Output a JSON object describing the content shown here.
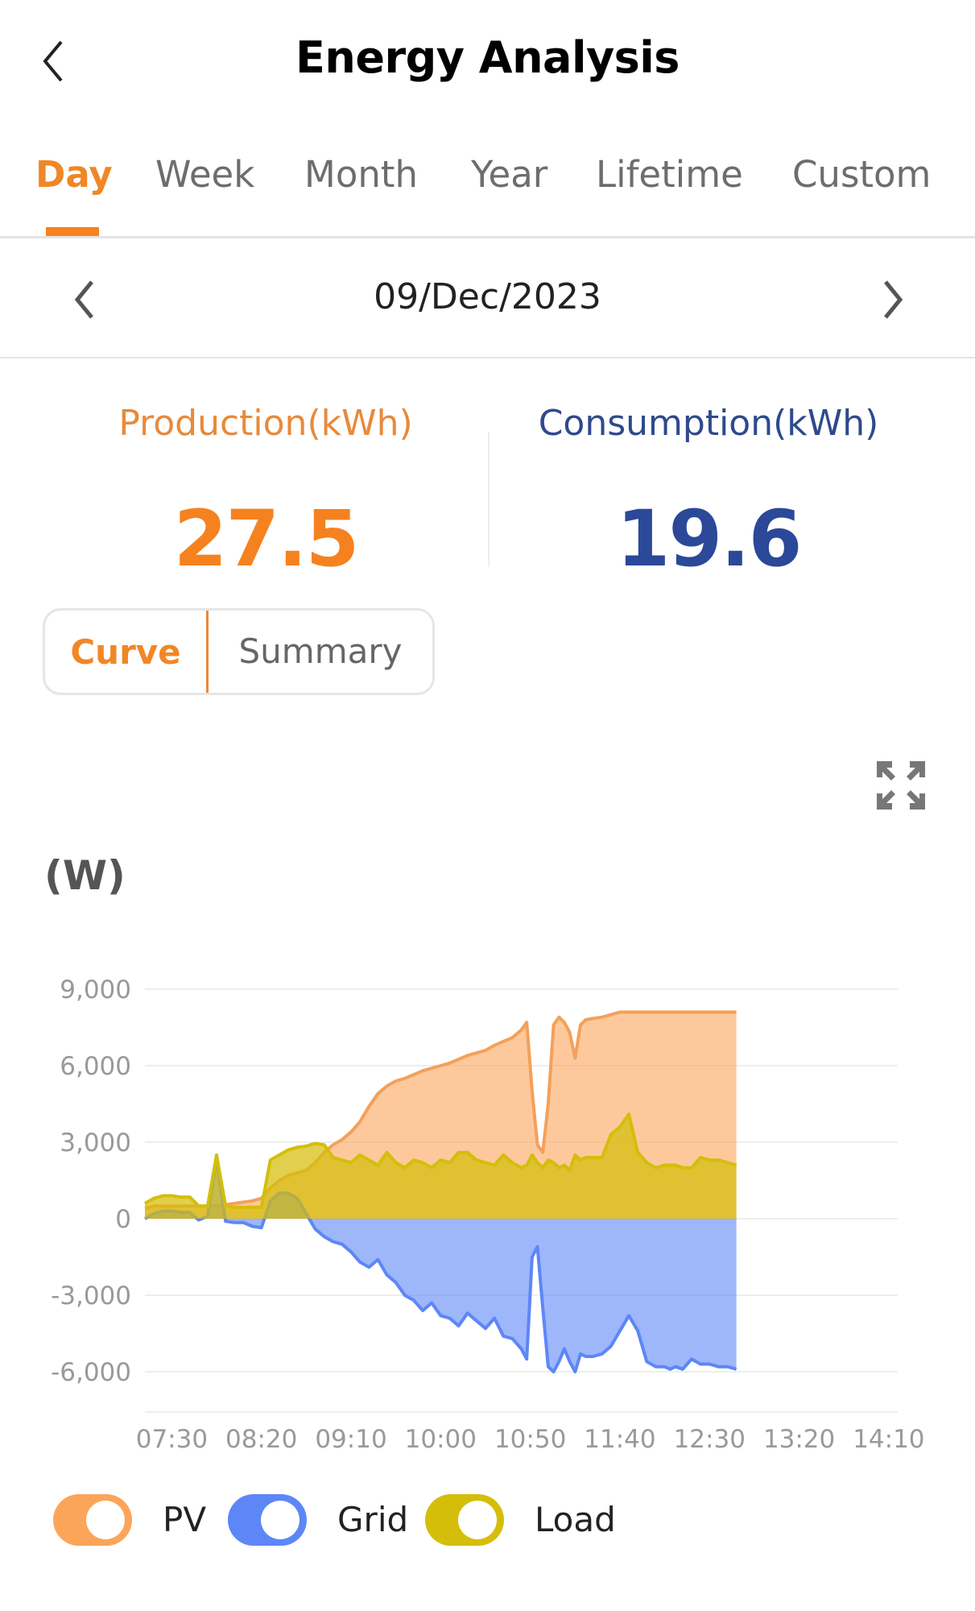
{
  "header": {
    "title": "Energy Analysis",
    "back_icon": "chevron-left-icon"
  },
  "tabs": [
    {
      "label": "Day",
      "active": true
    },
    {
      "label": "Week",
      "active": false
    },
    {
      "label": "Month",
      "active": false
    },
    {
      "label": "Year",
      "active": false
    },
    {
      "label": "Lifetime",
      "active": false
    },
    {
      "label": "Custom",
      "active": false
    }
  ],
  "date_nav": {
    "date": "09/Dec/2023",
    "prev_icon": "chevron-left-icon",
    "next_icon": "chevron-right-icon"
  },
  "stats": {
    "production": {
      "label": "Production(kWh)",
      "value": "27.5"
    },
    "consumption": {
      "label": "Consumption(kWh)",
      "value": "19.6"
    }
  },
  "view_toggle": {
    "curve": "Curve",
    "summary": "Summary",
    "selected": "Curve"
  },
  "expand_icon": "fullscreen-expand-icon",
  "colors": {
    "accent": "#f5821f",
    "consumption": "#2b4899",
    "pv": "#fba55a",
    "grid": "#5d86f7",
    "load": "#d4be0a"
  },
  "chart_data": {
    "type": "area",
    "title": "",
    "ylabel": "(W)",
    "xlabel": "",
    "ylim": [
      -7000,
      9000
    ],
    "yticks": [
      9000,
      6000,
      3000,
      0,
      -3000,
      -6000
    ],
    "ytick_labels": [
      "9,000",
      "6,000",
      "3,000",
      "0",
      "-3,000",
      "-6,000"
    ],
    "xlim": [
      "07:15",
      "14:15"
    ],
    "xticks": [
      "07:30",
      "08:20",
      "09:10",
      "10:00",
      "10:50",
      "11:40",
      "12:30",
      "13:20",
      "14:10"
    ],
    "grid": true,
    "legend_position": "bottom-left",
    "x": [
      "07:15",
      "07:20",
      "07:25",
      "07:30",
      "07:35",
      "07:40",
      "07:45",
      "07:50",
      "07:55",
      "08:00",
      "08:05",
      "08:10",
      "08:15",
      "08:20",
      "08:25",
      "08:30",
      "08:35",
      "08:40",
      "08:45",
      "08:50",
      "08:55",
      "09:00",
      "09:05",
      "09:10",
      "09:15",
      "09:20",
      "09:25",
      "09:30",
      "09:35",
      "09:40",
      "09:45",
      "09:50",
      "09:55",
      "10:00",
      "10:05",
      "10:10",
      "10:15",
      "10:20",
      "10:25",
      "10:30",
      "10:35",
      "10:40",
      "10:45",
      "10:48",
      "10:51",
      "10:54",
      "10:57",
      "11:00",
      "11:03",
      "11:06",
      "11:09",
      "11:12",
      "11:15",
      "11:18",
      "11:21",
      "11:25",
      "11:30",
      "11:35",
      "11:40",
      "11:45",
      "11:50",
      "11:55",
      "12:00",
      "12:05",
      "12:08",
      "12:11",
      "12:15",
      "12:20",
      "12:25",
      "12:30",
      "12:35",
      "12:40",
      "12:45"
    ],
    "series": [
      {
        "name": "PV",
        "values": [
          400,
          500,
          500,
          500,
          500,
          500,
          500,
          500,
          500,
          550,
          600,
          650,
          700,
          800,
          1200,
          1500,
          1700,
          1800,
          1900,
          2200,
          2600,
          2900,
          3100,
          3400,
          3800,
          4400,
          4900,
          5200,
          5400,
          5500,
          5650,
          5800,
          5900,
          6000,
          6100,
          6250,
          6400,
          6500,
          6600,
          6800,
          6950,
          7100,
          7400,
          7700,
          5000,
          2900,
          2600,
          4500,
          7600,
          7900,
          7700,
          7300,
          6300,
          7600,
          7800,
          7850,
          7900,
          8000,
          8100,
          8100,
          8100,
          8100,
          8100,
          8100,
          8100,
          8100,
          8100,
          8100,
          8100,
          8100,
          8100,
          8100,
          8100
        ]
      },
      {
        "name": "Grid",
        "values": [
          0,
          200,
          300,
          300,
          250,
          250,
          -50,
          100,
          2300,
          -100,
          -150,
          -150,
          -300,
          -350,
          700,
          1000,
          1000,
          800,
          200,
          -400,
          -700,
          -900,
          -1000,
          -1300,
          -1700,
          -1900,
          -1600,
          -2200,
          -2500,
          -3000,
          -3200,
          -3600,
          -3300,
          -3800,
          -3900,
          -4200,
          -3700,
          -4000,
          -4300,
          -3900,
          -4600,
          -4700,
          -5100,
          -5500,
          -1500,
          -1100,
          -3500,
          -5800,
          -6000,
          -5600,
          -5100,
          -5600,
          -6000,
          -5300,
          -5400,
          -5400,
          -5300,
          -5000,
          -4400,
          -3800,
          -4400,
          -5600,
          -5800,
          -5800,
          -5900,
          -5800,
          -5900,
          -5500,
          -5700,
          -5700,
          -5800,
          -5800,
          -5900
        ]
      },
      {
        "name": "Load",
        "values": [
          600,
          800,
          900,
          900,
          850,
          850,
          500,
          500,
          2500,
          500,
          450,
          450,
          450,
          450,
          2300,
          2500,
          2700,
          2800,
          2850,
          2950,
          2900,
          2400,
          2300,
          2200,
          2500,
          2300,
          2100,
          2600,
          2200,
          2000,
          2300,
          2200,
          2000,
          2300,
          2200,
          2600,
          2600,
          2300,
          2200,
          2100,
          2500,
          2200,
          2000,
          2100,
          2500,
          2200,
          2000,
          2300,
          2200,
          2000,
          2100,
          1900,
          2500,
          2300,
          2400,
          2400,
          2400,
          3300,
          3600,
          4100,
          2600,
          2200,
          2000,
          2100,
          2100,
          2100,
          2000,
          2000,
          2400,
          2300,
          2300,
          2200,
          2100
        ]
      }
    ]
  },
  "legend": [
    {
      "label": "PV",
      "icon": "toggle-on-icon"
    },
    {
      "label": "Grid",
      "icon": "toggle-on-icon"
    },
    {
      "label": "Load",
      "icon": "toggle-on-icon"
    }
  ]
}
